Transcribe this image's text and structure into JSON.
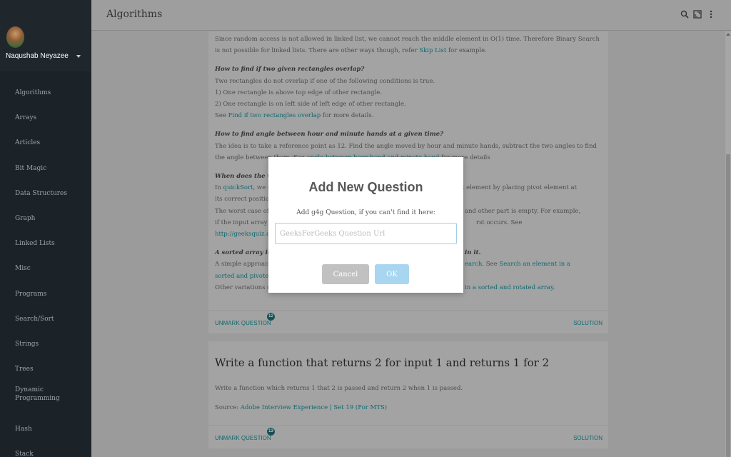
{
  "app": {
    "title": "Algorithms"
  },
  "user": {
    "name": "Naqushab Neyazee"
  },
  "nav": [
    "Algorithms",
    "Arrays",
    "Articles",
    "Bit Magic",
    "Data Structures",
    "Graph",
    "Linked Lists",
    "Misc",
    "Programs",
    "Search/Sort",
    "Strings",
    "Trees",
    "Dynamic Programming",
    "Hash",
    "Stack"
  ],
  "card1": {
    "p1a": "Since random access is not allowed in linked list, we cannot reach the middle element in O(1) time. Therefore Binary Search is not possible for linked lists. There are other ways though, refer ",
    "p1link": "Skip List",
    "p1b": " for example.",
    "q2": "How to find if two given rectangles overlap?",
    "q2l1": "Two rectangles do not overlap if one of the following conditions is true.",
    "q2l2": "1) One rectangle is above top edge of other rectangle.",
    "q2l3": "2) One rectangle is on left side of left edge of other rectangle.",
    "q2l4a": "See ",
    "q2link": "Find if two rectangles overlap",
    "q2l4b": " for more details.",
    "q3": "How to find angle between hour and minute hands at a given time?",
    "q3a": "The idea is to take a reference point as 12. Find the angle moved by hour and minute hands, subtract the two angles to find the angle between them. See ",
    "q3link": "angle between hour hand and minute hand",
    "q3b": " for more details",
    "q4": "When does the wo",
    "q4l1a": "In ",
    "q4link": "quickSort",
    "q4l1b": ", we se",
    "q4l1c": "t element by placing pivot element at",
    "q4l2": "its correct position",
    "q4l3a": "The worst case of",
    "q4l3b": "and other part is empty. For example,",
    "q4l4a": "if the input array i",
    "q4l4b": "rst occurs. See",
    "q4l5": "http://geeksquiz.co",
    "q5a": "A sorted array is r",
    "q5b": "in it.",
    "q5l1a": "A simple approach",
    "q5l1link": "earch",
    "q5l1b": ". See ",
    "q5l1link2": "Search an element in a",
    "q5l2link": "sorted and pivoted",
    "q5l3a": "Other variations of",
    "q5l3link": "in a sorted and rotated array.",
    "unmark": "UNMARK QUESTION",
    "badge": "12",
    "solution": "SOLUTION"
  },
  "card2": {
    "title": "Write a function that returns 2 for input 1 and returns 1 for 2",
    "desc": "Write a function which returns 1 that 2 is passed and return 2 when 1 is passed.",
    "source_label": "Source: ",
    "source_link": "Adobe Interview Experience | Set 19 (For MTS)",
    "unmark": "UNMARK QUESTION",
    "badge": "13",
    "solution": "SOLUTION"
  },
  "modal": {
    "title": "Add New Question",
    "text": "Add g4g Question, if you can't find it here:",
    "placeholder": "GeeksForGeeks Question Url",
    "cancel": "Cancel",
    "ok": "OK"
  },
  "icons": {
    "search": "search-icon",
    "fullscreen": "fullscreen-icon",
    "more": "more-vert-icon"
  },
  "colors": {
    "sidebar": "#1c2328",
    "link": "#0e6a70",
    "ok_button": "#a8d6f0",
    "cancel_button": "#c1c1c1"
  }
}
